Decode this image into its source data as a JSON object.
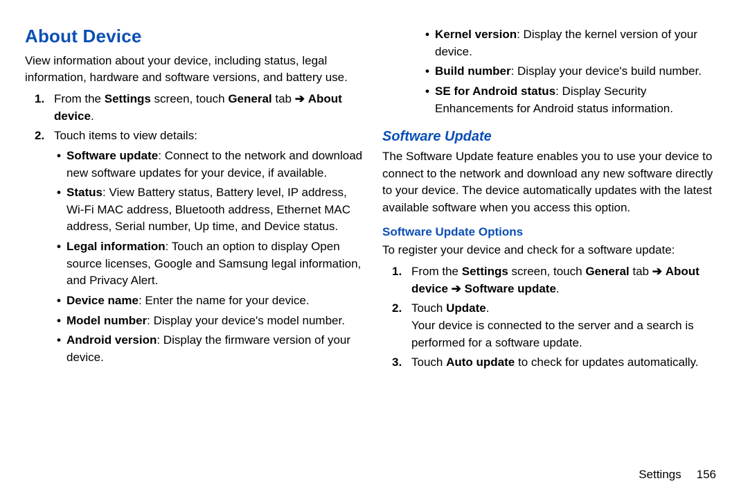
{
  "page": {
    "section_label": "Settings",
    "page_number": "156"
  },
  "arrow": "➔",
  "left": {
    "heading": "About Device",
    "intro": "View information about your device, including status, legal information, hardware and software versions, and battery use.",
    "step1_num": "1.",
    "step1_a": "From the ",
    "step1_b": "Settings",
    "step1_c": " screen, touch ",
    "step1_d": "General",
    "step1_e": " tab ",
    "step1_f": "About device",
    "step1_g": ".",
    "step2_num": "2.",
    "step2_text": "Touch items to view details:",
    "b_sw_t": "Software update",
    "b_sw_d": ": Connect to the network and download new software updates for your device, if available.",
    "b_status_t": "Status",
    "b_status_d": ": View Battery status, Battery level, IP address, Wi-Fi MAC address, Bluetooth address, Ethernet MAC address, Serial number, Up time, and Device status.",
    "b_legal_t": "Legal information",
    "b_legal_d": ": Touch an option to display Open source licenses, Google and Samsung legal information, and Privacy Alert.",
    "b_name_t": "Device name",
    "b_name_d": ": Enter the name for your device.",
    "b_model_t": "Model number",
    "b_model_d": ": Display your device's model number.",
    "b_and_t": "Android version",
    "b_and_d": ": Display the firmware version of your device."
  },
  "right": {
    "b_kernel_t": "Kernel version",
    "b_kernel_d": ": Display the kernel version of your device.",
    "b_build_t": "Build number",
    "b_build_d": ": Display your device's build number.",
    "b_se_t": "SE for Android status",
    "b_se_d": ": Display Security Enhancements for Android status information.",
    "sw_heading": "Software Update",
    "sw_intro": "The Software Update feature enables you to use your device to connect to the network and download any new software directly to your device. The device automatically updates with the latest available software when you access this option.",
    "sw_opts_heading": "Software Update Options",
    "sw_opts_intro": "To register your device and check for a software update:",
    "s1_num": "1.",
    "s1_a": "From the ",
    "s1_b": "Settings",
    "s1_c": " screen, touch ",
    "s1_d": "General",
    "s1_e": " tab ",
    "s1_f": "About device",
    "s1_g": "Software update",
    "s1_h": ".",
    "s2_num": "2.",
    "s2_a": "Touch ",
    "s2_b": "Update",
    "s2_c": ".",
    "s2_body": "Your device is connected to the server and a search is performed for a software update.",
    "s3_num": "3.",
    "s3_a": "Touch ",
    "s3_b": "Auto update",
    "s3_c": " to check for updates automatically."
  }
}
